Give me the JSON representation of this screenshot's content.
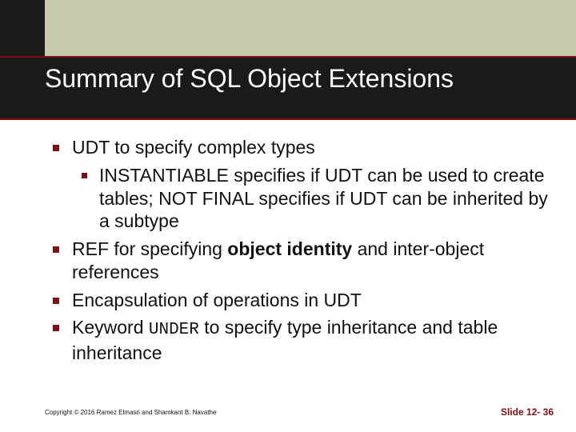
{
  "title": "Summary of SQL Object Extensions",
  "bullets": {
    "b1": "UDT to specify complex types",
    "b1_1": "INSTANTIABLE specifies if UDT can be used to create tables; NOT FINAL specifies if UDT can be inherited by a subtype",
    "b2_pre": "REF for specifying ",
    "b2_bold": "object identity",
    "b2_post": " and inter-object references",
    "b3": "Encapsulation of operations in UDT",
    "b4_pre": "Keyword ",
    "b4_kw": "UNDER",
    "b4_post": " to specify type inheritance and table inheritance"
  },
  "footer": {
    "copyright": "Copyright © 2016 Ramez Elmasri and Shamkant B. Navathe",
    "slide_label": "Slide 12- 36"
  }
}
